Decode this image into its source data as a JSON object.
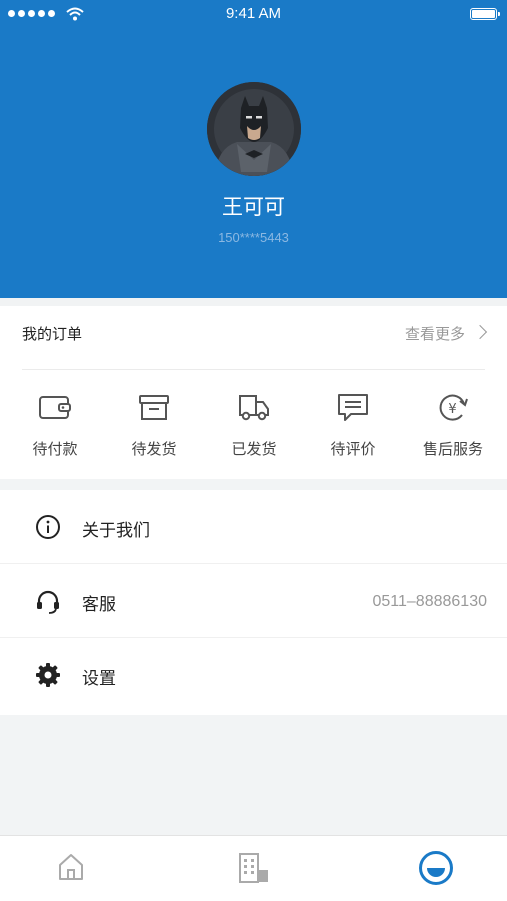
{
  "status_bar": {
    "time": "9:41 AM"
  },
  "profile": {
    "name": "王可可",
    "phone": "150****5443"
  },
  "orders": {
    "title": "我的订单",
    "more_label": "查看更多",
    "items": [
      {
        "label": "待付款",
        "icon": "wallet-icon"
      },
      {
        "label": "待发货",
        "icon": "box-icon"
      },
      {
        "label": "已发货",
        "icon": "truck-icon"
      },
      {
        "label": "待评价",
        "icon": "comment-icon"
      },
      {
        "label": "售后服务",
        "icon": "yuan-refresh-icon"
      }
    ]
  },
  "menu": [
    {
      "label": "关于我们",
      "icon": "info-icon",
      "value": ""
    },
    {
      "label": "客服",
      "icon": "headset-icon",
      "value": "0511–88886130"
    },
    {
      "label": "设置",
      "icon": "gear-icon",
      "value": ""
    }
  ],
  "tabbar": {
    "active_color": "#1a7ac7",
    "items": [
      {
        "icon": "home-icon",
        "active": false
      },
      {
        "icon": "building-icon",
        "active": false
      },
      {
        "icon": "profile-smile-icon",
        "active": true
      }
    ]
  },
  "colors": {
    "header_bg": "#1a7ac7"
  }
}
